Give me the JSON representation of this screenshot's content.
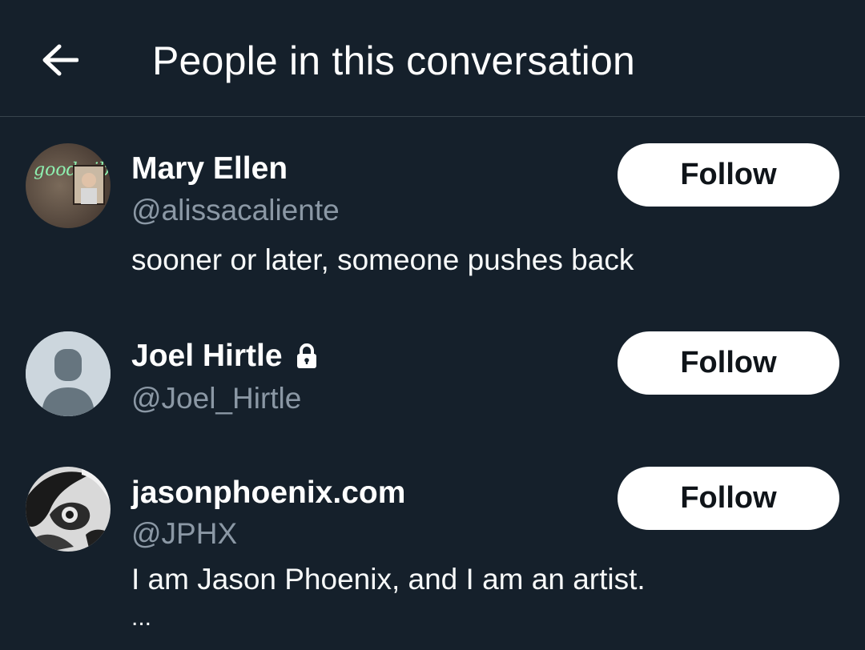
{
  "header": {
    "title": "People in this conversation",
    "back_icon": "arrow-left-icon"
  },
  "people": [
    {
      "name": "Mary Ellen",
      "handle": "@alissacaliente",
      "bio": "sooner or later, someone pushes back",
      "follow_label": "Follow",
      "avatar_text": "good vibes",
      "protected": false
    },
    {
      "name": "Joel Hirtle",
      "handle": "@Joel_Hirtle",
      "bio": "",
      "follow_label": "Follow",
      "protected": true,
      "protected_icon": "lock-icon"
    },
    {
      "name": "jasonphoenix.com",
      "handle": "@JPHX",
      "bio": "I am Jason Phoenix, and I am an artist.",
      "bio_more": "...",
      "follow_label": "Follow",
      "protected": false
    }
  ],
  "colors": {
    "background": "#15202b",
    "divider": "#38444d",
    "secondary_text": "#8b98a5",
    "button_bg": "#ffffff",
    "button_text": "#0f1419"
  }
}
